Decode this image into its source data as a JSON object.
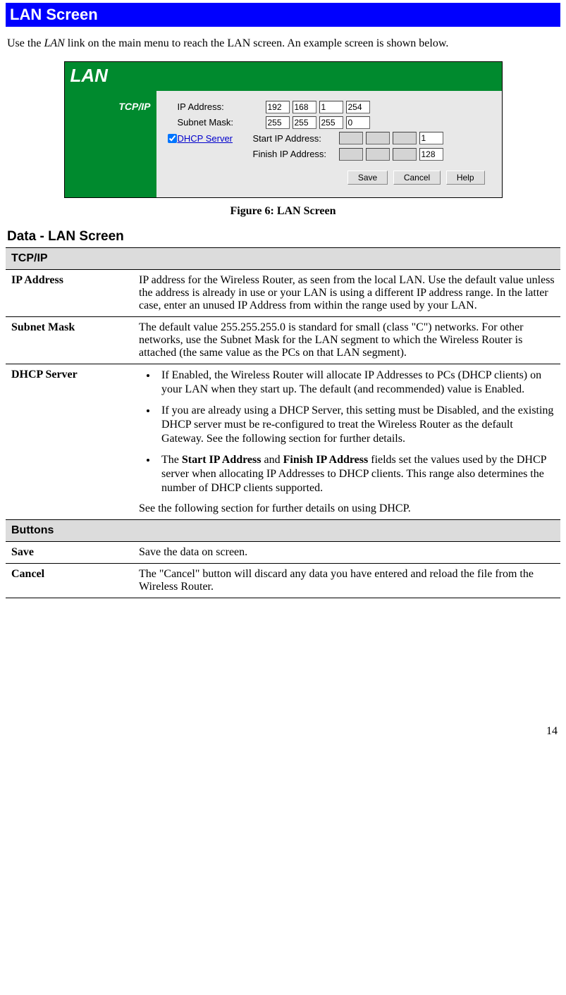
{
  "title": "LAN Screen",
  "intro_pre": "Use the ",
  "intro_em": "LAN",
  "intro_post": " link on the main menu to reach the LAN screen. An example screen is shown below.",
  "figure": {
    "header": "LAN",
    "side_label": "TCP/IP",
    "rows": {
      "ip_label": "IP Address:",
      "ip": [
        "192",
        "168",
        "1",
        "254"
      ],
      "mask_label": "Subnet Mask:",
      "mask": [
        "255",
        "255",
        "255",
        "0"
      ],
      "dhcp_link": "DHCP Server",
      "start_label": "Start IP Address:",
      "start": [
        "",
        "",
        "",
        "1"
      ],
      "finish_label": "Finish IP Address:",
      "finish": [
        "",
        "",
        "",
        "128"
      ]
    },
    "buttons": {
      "save": "Save",
      "cancel": "Cancel",
      "help": "Help"
    }
  },
  "caption": "Figure 6: LAN Screen",
  "section_heading": "Data - LAN Screen",
  "table": {
    "group_tcpip": "TCP/IP",
    "ip_label": "IP Address",
    "ip_desc": "IP address for the Wireless Router, as seen from the local LAN. Use the default value unless the address is already in use or your LAN is using a different IP address range. In the latter case, enter an unused IP Address from within the range used by your LAN.",
    "mask_label": "Subnet Mask",
    "mask_desc": "The default value 255.255.255.0 is standard for small (class \"C\") networks. For other networks, use the Subnet Mask for the LAN segment to which the Wireless Router is attached (the same value as the PCs on that LAN segment).",
    "dhcp_label": "DHCP Server",
    "dhcp_b1": "If Enabled, the Wireless Router will allocate IP Addresses to PCs (DHCP clients) on your LAN when they start up. The default (and recommended) value is Enabled.",
    "dhcp_b2": "If you are already using a DHCP Server, this setting must be Disabled, and the existing DHCP server must be re-configured to treat the Wireless Router as the default Gateway. See the following section for further details.",
    "dhcp_b3_pre": "The ",
    "dhcp_b3_s1": "Start IP Address",
    "dhcp_b3_mid": " and ",
    "dhcp_b3_s2": "Finish IP Address",
    "dhcp_b3_post": " fields set the values used by the DHCP server when allocating IP Addresses to DHCP clients. This range also determines the number of DHCP clients supported.",
    "dhcp_tail": "See the following section for further details on using DHCP.",
    "group_buttons": "Buttons",
    "save_label": "Save",
    "save_desc": "Save the data on screen.",
    "cancel_label": "Cancel",
    "cancel_desc": "The \"Cancel\" button will discard any data you have entered and reload the file from the Wireless Router."
  },
  "page_number": "14"
}
